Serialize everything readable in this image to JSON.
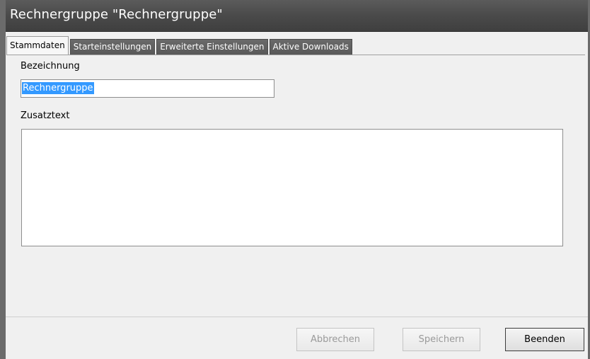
{
  "window": {
    "title": "Rechnergruppe \"Rechnergruppe\""
  },
  "tabs": [
    {
      "label": "Stammdaten",
      "active": true
    },
    {
      "label": "Starteinstellungen",
      "active": false
    },
    {
      "label": "Erweiterte Einstellungen",
      "active": false
    },
    {
      "label": "Aktive Downloads",
      "active": false
    }
  ],
  "form": {
    "bezeichnung_label": "Bezeichnung",
    "bezeichnung_value": "Rechnergruppe",
    "zusatztext_label": "Zusatztext",
    "zusatztext_value": ""
  },
  "buttons": {
    "abbrechen": {
      "label": "Abbrechen",
      "enabled": false
    },
    "speichern": {
      "label": "Speichern",
      "enabled": false
    },
    "beenden": {
      "label": "Beenden",
      "enabled": true
    }
  },
  "colors": {
    "titlebar": "#4a4a4a",
    "selection": "#3399ff",
    "background": "#f0f0f0"
  }
}
